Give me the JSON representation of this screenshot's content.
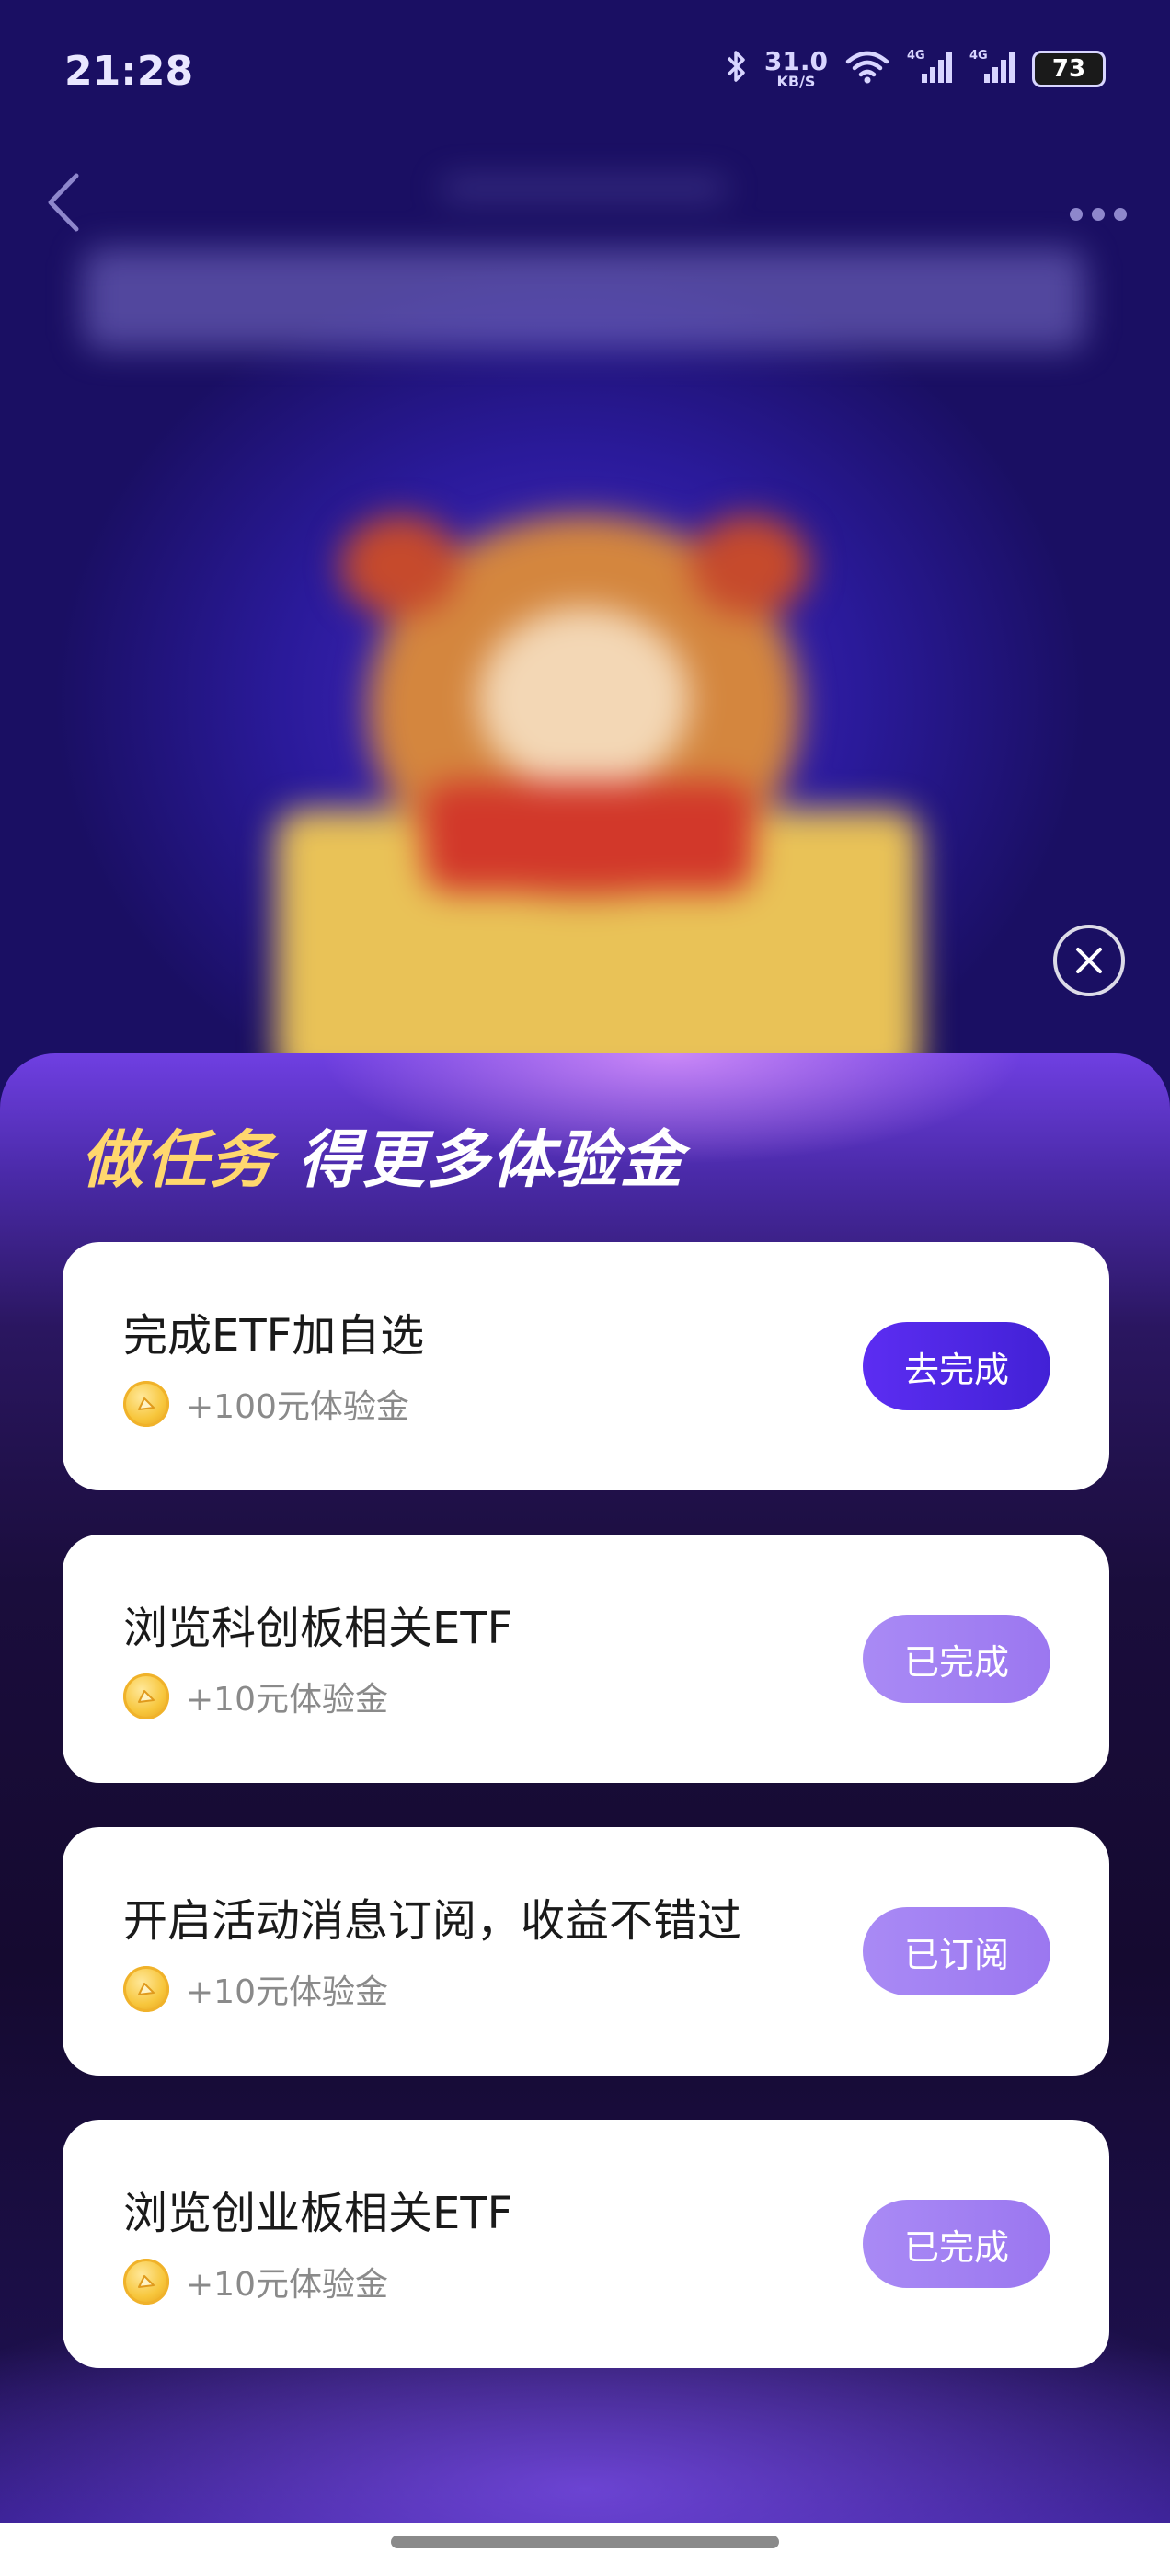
{
  "status_bar": {
    "time": "21:28",
    "net_speed_value": "31.0",
    "net_speed_unit": "KB/S",
    "signal_1_label": "4G",
    "signal_2_label": "4G",
    "battery": "73",
    "icons": [
      "bluetooth-icon",
      "wifi-icon",
      "cellular-signal-icon",
      "cellular-signal-icon"
    ]
  },
  "nav": {
    "back_icon": "chevron-left-icon",
    "more_icon": "more-dots-icon"
  },
  "close_icon": "close-icon",
  "sheet": {
    "title_part1": "做任务",
    "title_part2": "得更多体验金",
    "tasks": [
      {
        "title": "完成ETF加自选",
        "reward": "+100元体验金",
        "button": "去完成",
        "status": "pending"
      },
      {
        "title": "浏览科创板相关ETF",
        "reward": "+10元体验金",
        "button": "已完成",
        "status": "done"
      },
      {
        "title": "开启活动消息订阅，收益不错过",
        "reward": "+10元体验金",
        "button": "已订阅",
        "status": "done"
      },
      {
        "title": "浏览创业板相关ETF",
        "reward": "+10元体验金",
        "button": "已完成",
        "status": "done"
      }
    ]
  },
  "colors": {
    "primary_button": "#4a25e0",
    "done_button": "#a283f3",
    "title_gold": "#ffd76e",
    "coin": "#f7c63c"
  }
}
